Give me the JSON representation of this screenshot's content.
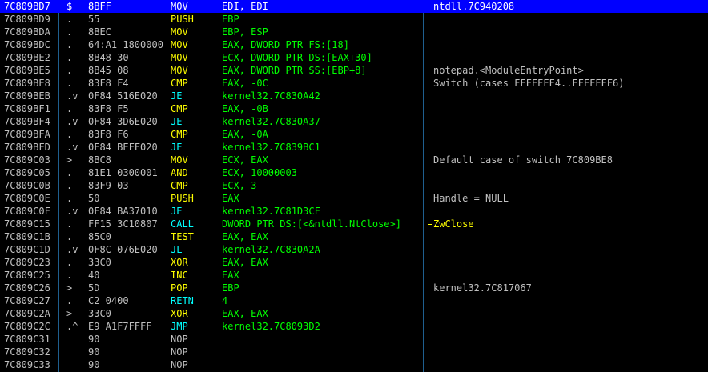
{
  "colors": {
    "background": "#000000",
    "selection": "#0000ff",
    "address": "#c0c0c0",
    "operand": "#00ff00",
    "comment": "#c0c0c0",
    "mnemonic_data": "#ffff00",
    "mnemonic_jump": "#00ffff",
    "mnemonic_call": "#00ffff",
    "mnemonic_stack": "#ffff00",
    "mnemonic_nop": "#c0c0c0",
    "comment_highlight": "#ffff00"
  },
  "rows": [
    {
      "addr": "7C809BD7",
      "mark": "$",
      "hex": "8BFF",
      "mn": "MOV",
      "kind": "data",
      "op": "EDI, EDI",
      "cm": "ntdll.7C940208",
      "selected": true
    },
    {
      "addr": "7C809BD9",
      "mark": ".",
      "hex": "55",
      "mn": "PUSH",
      "kind": "stack",
      "op": "EBP",
      "cm": ""
    },
    {
      "addr": "7C809BDA",
      "mark": ".",
      "hex": "8BEC",
      "mn": "MOV",
      "kind": "data",
      "op": "EBP, ESP",
      "cm": ""
    },
    {
      "addr": "7C809BDC",
      "mark": ".",
      "hex": "64:A1 1800000",
      "mn": "MOV",
      "kind": "data",
      "op": "EAX, DWORD PTR FS:[18]",
      "cm": ""
    },
    {
      "addr": "7C809BE2",
      "mark": ".",
      "hex": "8B48 30",
      "mn": "MOV",
      "kind": "data",
      "op": "ECX, DWORD PTR DS:[EAX+30]",
      "cm": ""
    },
    {
      "addr": "7C809BE5",
      "mark": ".",
      "hex": "8B45 08",
      "mn": "MOV",
      "kind": "data",
      "op": "EAX, DWORD PTR SS:[EBP+8]",
      "cm": "notepad.<ModuleEntryPoint>"
    },
    {
      "addr": "7C809BE8",
      "mark": ".",
      "hex": "83F8 F4",
      "mn": "CMP",
      "kind": "data",
      "op": "EAX, -0C",
      "cm": "Switch (cases FFFFFFF4..FFFFFFF6)"
    },
    {
      "addr": "7C809BEB",
      "mark": ".v",
      "hex": "0F84 516E020",
      "mn": "JE",
      "kind": "jump",
      "op": "kernel32.7C830A42",
      "cm": ""
    },
    {
      "addr": "7C809BF1",
      "mark": ".",
      "hex": "83F8 F5",
      "mn": "CMP",
      "kind": "data",
      "op": "EAX, -0B",
      "cm": ""
    },
    {
      "addr": "7C809BF4",
      "mark": ".v",
      "hex": "0F84 3D6E020",
      "mn": "JE",
      "kind": "jump",
      "op": "kernel32.7C830A37",
      "cm": ""
    },
    {
      "addr": "7C809BFA",
      "mark": ".",
      "hex": "83F8 F6",
      "mn": "CMP",
      "kind": "data",
      "op": "EAX, -0A",
      "cm": ""
    },
    {
      "addr": "7C809BFD",
      "mark": ".v",
      "hex": "0F84 BEFF020",
      "mn": "JE",
      "kind": "jump",
      "op": "kernel32.7C839BC1",
      "cm": ""
    },
    {
      "addr": "7C809C03",
      "mark": ">",
      "hex": "8BC8",
      "mn": "MOV",
      "kind": "data",
      "op": "ECX, EAX",
      "cm": "Default case of switch 7C809BE8"
    },
    {
      "addr": "7C809C05",
      "mark": ".",
      "hex": "81E1 0300001",
      "mn": "AND",
      "kind": "data",
      "op": "ECX, 10000003",
      "cm": ""
    },
    {
      "addr": "7C809C0B",
      "mark": ".",
      "hex": "83F9 03",
      "mn": "CMP",
      "kind": "data",
      "op": "ECX, 3",
      "cm": ""
    },
    {
      "addr": "7C809C0E",
      "mark": ".",
      "hex": "50",
      "mn": "PUSH",
      "kind": "stack",
      "op": "EAX",
      "cm": "Handle = NULL"
    },
    {
      "addr": "7C809C0F",
      "mark": ".v",
      "hex": "0F84 BA37010",
      "mn": "JE",
      "kind": "jump",
      "op": "kernel32.7C81D3CF",
      "cm": ""
    },
    {
      "addr": "7C809C15",
      "mark": ".",
      "hex": "FF15 3C10807",
      "mn": "CALL",
      "kind": "call",
      "op": "DWORD PTR DS:[<&ntdll.NtClose>]",
      "cm": "ZwClose",
      "cm_hl": true
    },
    {
      "addr": "7C809C1B",
      "mark": ".",
      "hex": "85C0",
      "mn": "TEST",
      "kind": "data",
      "op": "EAX, EAX",
      "cm": ""
    },
    {
      "addr": "7C809C1D",
      "mark": ".v",
      "hex": "0F8C 076E020",
      "mn": "JL",
      "kind": "jump",
      "op": "kernel32.7C830A2A",
      "cm": ""
    },
    {
      "addr": "7C809C23",
      "mark": ".",
      "hex": "33C0",
      "mn": "XOR",
      "kind": "data",
      "op": "EAX, EAX",
      "cm": ""
    },
    {
      "addr": "7C809C25",
      "mark": ".",
      "hex": "40",
      "mn": "INC",
      "kind": "data",
      "op": "EAX",
      "cm": ""
    },
    {
      "addr": "7C809C26",
      "mark": ">",
      "hex": "5D",
      "mn": "POP",
      "kind": "stack",
      "op": "EBP",
      "cm": "kernel32.7C817067"
    },
    {
      "addr": "7C809C27",
      "mark": ".",
      "hex": "C2 0400",
      "mn": "RETN",
      "kind": "call",
      "op": "4",
      "cm": ""
    },
    {
      "addr": "7C809C2A",
      "mark": ">",
      "hex": "33C0",
      "mn": "XOR",
      "kind": "data",
      "op": "EAX, EAX",
      "cm": ""
    },
    {
      "addr": "7C809C2C",
      "mark": ".^",
      "hex": "E9 A1F7FFFF",
      "mn": "JMP",
      "kind": "jump",
      "op": "kernel32.7C8093D2",
      "cm": ""
    },
    {
      "addr": "7C809C31",
      "mark": "",
      "hex": "90",
      "mn": "NOP",
      "kind": "nop",
      "op": "",
      "cm": ""
    },
    {
      "addr": "7C809C32",
      "mark": "",
      "hex": "90",
      "mn": "NOP",
      "kind": "nop",
      "op": "",
      "cm": ""
    },
    {
      "addr": "7C809C33",
      "mark": "",
      "hex": "90",
      "mn": "NOP",
      "kind": "nop",
      "op": "",
      "cm": ""
    }
  ]
}
